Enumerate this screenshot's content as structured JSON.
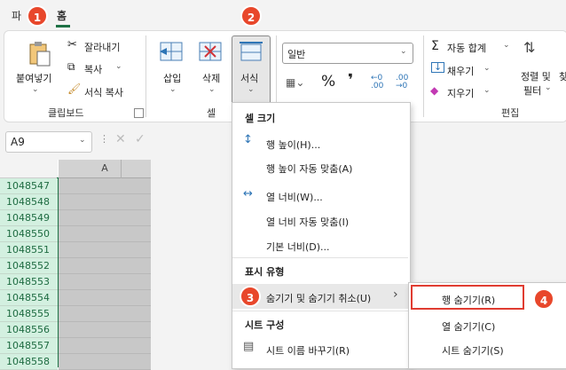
{
  "tabs": {
    "file": "파",
    "home": "홈"
  },
  "ribbon": {
    "paste": "붙여넣기",
    "cut": "잘라내기",
    "copy": "복사",
    "format_painter": "서식 복사",
    "clipboard_group": "클립보드",
    "insert": "삽입",
    "delete": "삭제",
    "format": "서식",
    "cells_group": "셀",
    "number_format": "일반",
    "percent_symbol": "%",
    "comma_symbol": "❜",
    "autosum": "자동 합계",
    "fill": "채우기",
    "clear": "지우기",
    "sort_filter_line1": "정렬 및",
    "sort_filter_line2": "필터",
    "find_select_initial": "찾",
    "editing_group": "편집"
  },
  "formula_bar": {
    "name_box": "A9"
  },
  "sheet": {
    "column_header": "A",
    "rows": [
      "1048547",
      "1048548",
      "1048549",
      "1048550",
      "1048551",
      "1048552",
      "1048553",
      "1048554",
      "1048555",
      "1048556",
      "1048557",
      "1048558"
    ]
  },
  "format_menu": {
    "cell_size": "셀 크기",
    "row_height": "행 높이(H)...",
    "autofit_row": "행 높이 자동 맞춤(A)",
    "col_width": "열 너비(W)...",
    "autofit_col": "열 너비 자동 맞춤(I)",
    "default_width": "기본 너비(D)...",
    "visibility": "표시 유형",
    "hide_unhide": "숨기기 및 숨기기 취소(U)",
    "organize_sheets": "시트 구성",
    "rename_sheet": "시트 이름 바꾸기(R)"
  },
  "hide_submenu": {
    "hide_rows": "행 숨기기(R)",
    "hide_cols": "열 숨기기(C)",
    "hide_sheet": "시트 숨기기(S)"
  },
  "badges": [
    "1",
    "2",
    "3",
    "4"
  ],
  "colors": {
    "accent": "#1e7145",
    "badge": "#e8472b",
    "highlight_box": "#e03c31"
  }
}
